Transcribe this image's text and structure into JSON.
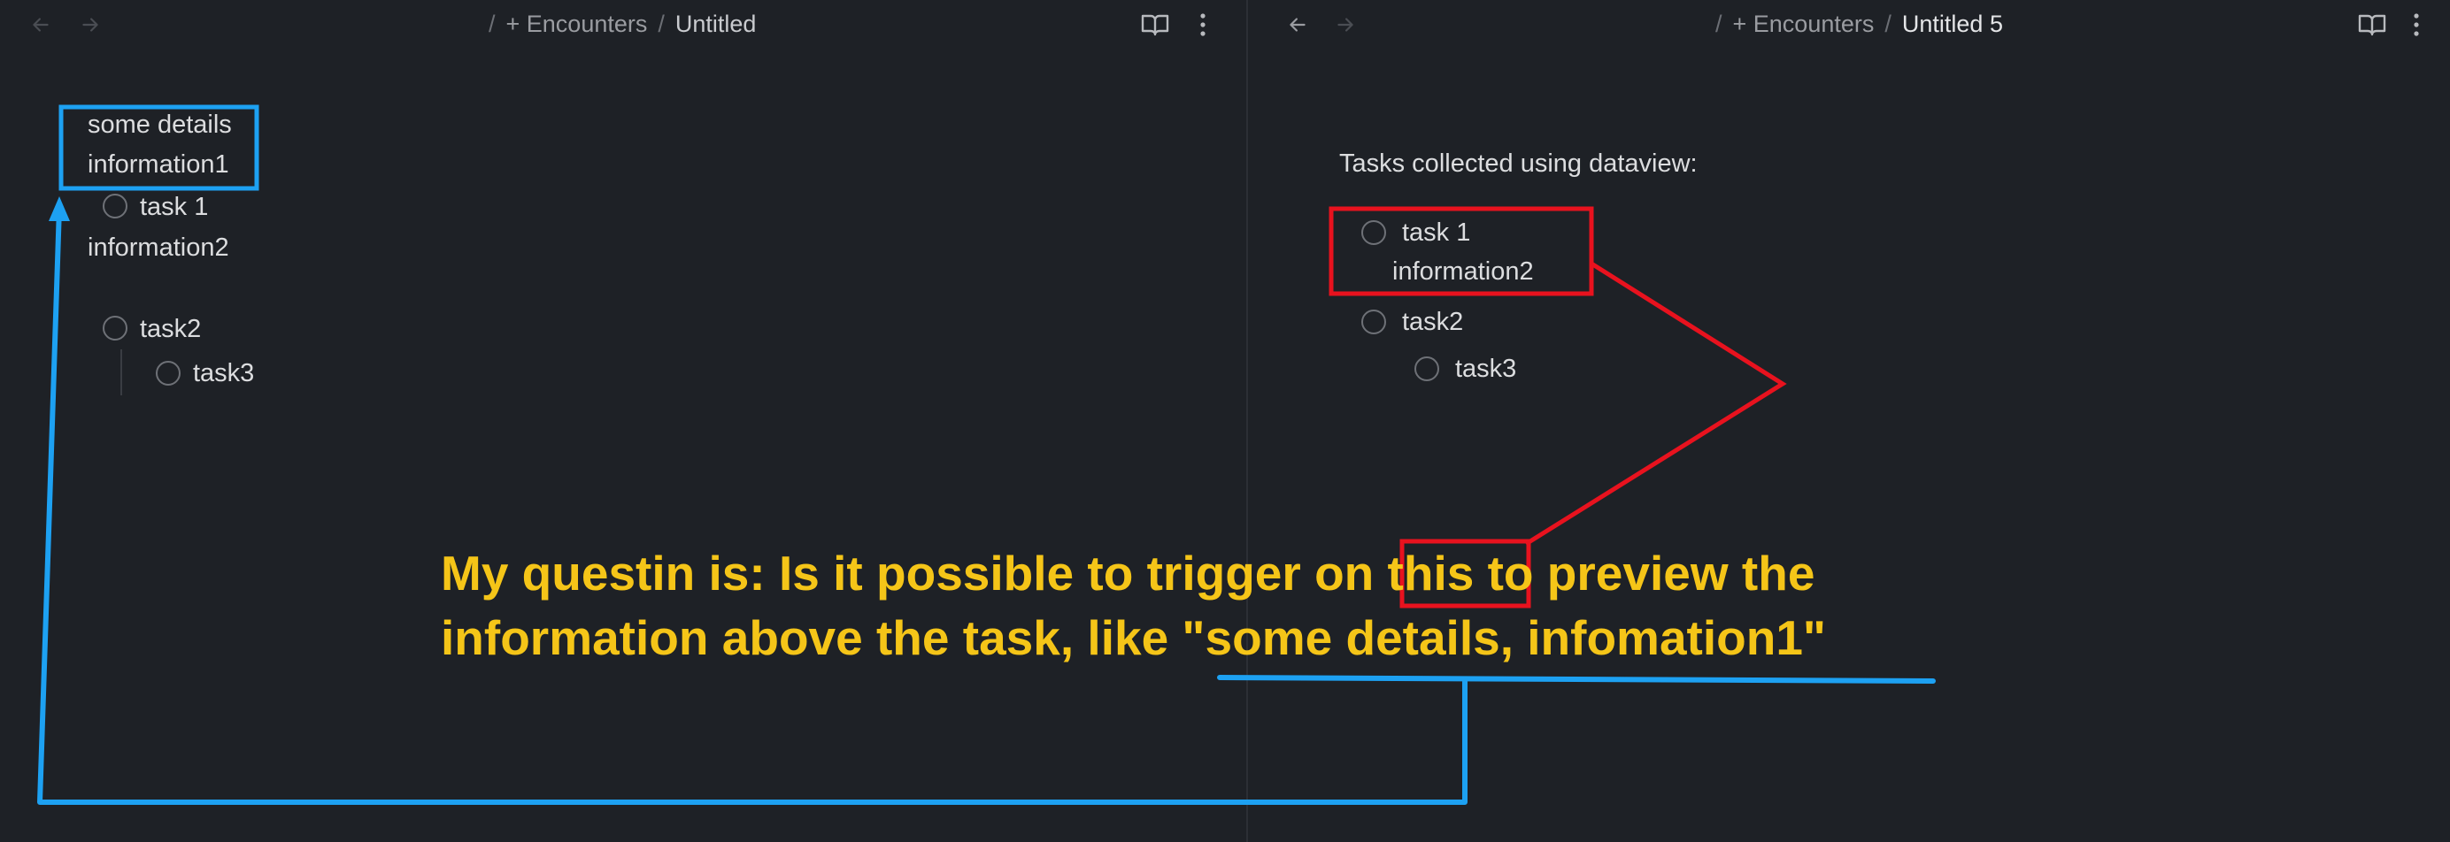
{
  "colors": {
    "background": "#1e2126",
    "annotation_blue": "#1da1f2",
    "annotation_red": "#e8121e",
    "annotation_yellow": "#f5c518"
  },
  "left_pane": {
    "nav": {
      "back_icon": "arrow-left-icon",
      "forward_icon": "arrow-right-icon"
    },
    "breadcrumb": {
      "sep1": "/",
      "folder": "+ Encounters",
      "sep2": "/",
      "note": "Untitled"
    },
    "tools": {
      "reading_icon": "book-open-icon",
      "more_icon": "more-vertical-icon"
    },
    "content": {
      "line1": "some details",
      "line2": "information1",
      "task1": "task 1",
      "line3": "information2",
      "task2": "task2",
      "task3": "task3"
    }
  },
  "right_pane": {
    "nav": {
      "back_icon": "arrow-left-icon",
      "forward_icon": "arrow-right-icon"
    },
    "breadcrumb": {
      "sep1": "/",
      "folder": "+ Encounters",
      "sep2": "/",
      "note": "Untitled 5"
    },
    "tools": {
      "reading_icon": "book-open-icon",
      "more_icon": "more-vertical-icon"
    },
    "content": {
      "heading": "Tasks collected using dataview:",
      "task1": "task 1",
      "task1_sub": "information2",
      "task2": "task2",
      "task3": "task3"
    }
  },
  "annotation": {
    "question_line1": "My questin is: Is it possible to trigger on this to preview the",
    "question_line2": "information above the task, like \"some details, infomation1\""
  }
}
